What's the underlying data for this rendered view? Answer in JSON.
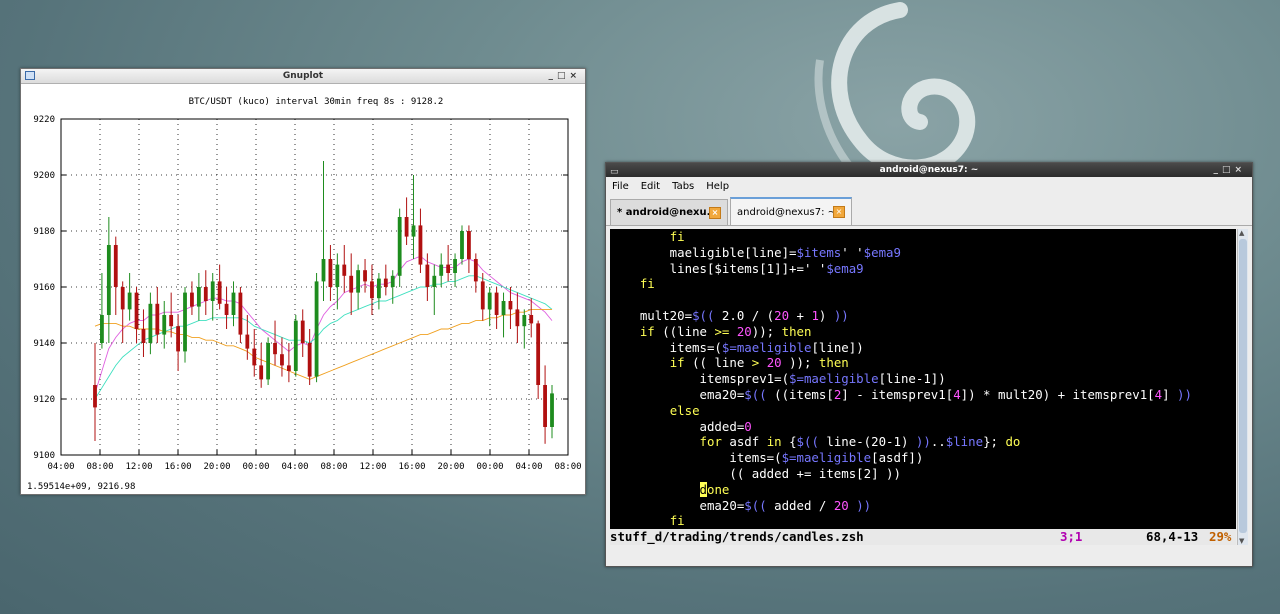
{
  "gnuplot": {
    "window_title": "Gnuplot",
    "status": "1.59514e+09,  9216.98"
  },
  "chart_data": {
    "type": "candlestick",
    "title": "BTC/USDT (kuco) interval 30min freq 8s : 9128.2",
    "xlabel": "",
    "ylabel": "",
    "ylim": [
      9100,
      9220
    ],
    "yticks": [
      "9100",
      "9120",
      "9140",
      "9160",
      "9180",
      "9200",
      "9220"
    ],
    "xticks": [
      "04:00",
      "08:00",
      "12:00",
      "16:00",
      "20:00",
      "00:00",
      "04:00",
      "08:00",
      "12:00",
      "16:00",
      "20:00",
      "00:00",
      "04:00",
      "08:00"
    ],
    "grid": true,
    "colors": {
      "up": "#1e8c1e",
      "down": "#b01010",
      "ema_a": "#e060e0",
      "ema_b": "#40e0c0",
      "ema_c": "#f0a020"
    },
    "candles": [
      [
        9125,
        9140,
        9105,
        9117
      ],
      [
        9140,
        9165,
        9138,
        9150
      ],
      [
        9150,
        9185,
        9140,
        9175
      ],
      [
        9175,
        9178,
        9150,
        9160
      ],
      [
        9160,
        9162,
        9140,
        9152
      ],
      [
        9152,
        9165,
        9148,
        9158
      ],
      [
        9158,
        9160,
        9140,
        9145
      ],
      [
        9145,
        9152,
        9135,
        9140
      ],
      [
        9140,
        9158,
        9136,
        9154
      ],
      [
        9154,
        9160,
        9140,
        9143
      ],
      [
        9143,
        9155,
        9138,
        9150
      ],
      [
        9150,
        9158,
        9142,
        9146
      ],
      [
        9146,
        9150,
        9130,
        9137
      ],
      [
        9137,
        9160,
        9133,
        9158
      ],
      [
        9158,
        9162,
        9150,
        9153
      ],
      [
        9153,
        9165,
        9148,
        9160
      ],
      [
        9160,
        9166,
        9150,
        9155
      ],
      [
        9155,
        9165,
        9148,
        9162
      ],
      [
        9162,
        9168,
        9152,
        9154
      ],
      [
        9154,
        9160,
        9145,
        9150
      ],
      [
        9150,
        9162,
        9146,
        9158
      ],
      [
        9158,
        9160,
        9140,
        9143
      ],
      [
        9143,
        9150,
        9134,
        9138
      ],
      [
        9138,
        9145,
        9128,
        9132
      ],
      [
        9132,
        9140,
        9124,
        9127
      ],
      [
        9127,
        9142,
        9125,
        9140
      ],
      [
        9140,
        9148,
        9132,
        9136
      ],
      [
        9136,
        9142,
        9128,
        9132
      ],
      [
        9132,
        9140,
        9126,
        9130
      ],
      [
        9130,
        9150,
        9128,
        9148
      ],
      [
        9148,
        9152,
        9135,
        9140
      ],
      [
        9140,
        9145,
        9125,
        9128
      ],
      [
        9128,
        9165,
        9126,
        9162
      ],
      [
        9162,
        9205,
        9155,
        9170
      ],
      [
        9170,
        9175,
        9155,
        9160
      ],
      [
        9160,
        9172,
        9152,
        9168
      ],
      [
        9168,
        9175,
        9158,
        9164
      ],
      [
        9164,
        9172,
        9150,
        9158
      ],
      [
        9158,
        9168,
        9152,
        9166
      ],
      [
        9166,
        9170,
        9158,
        9162
      ],
      [
        9162,
        9168,
        9150,
        9156
      ],
      [
        9156,
        9165,
        9152,
        9163
      ],
      [
        9163,
        9168,
        9157,
        9160
      ],
      [
        9160,
        9166,
        9154,
        9164
      ],
      [
        9164,
        9188,
        9160,
        9185
      ],
      [
        9185,
        9192,
        9175,
        9178
      ],
      [
        9178,
        9200,
        9170,
        9182
      ],
      [
        9182,
        9188,
        9165,
        9168
      ],
      [
        9168,
        9172,
        9155,
        9160
      ],
      [
        9160,
        9168,
        9150,
        9164
      ],
      [
        9164,
        9172,
        9160,
        9168
      ],
      [
        9168,
        9175,
        9162,
        9165
      ],
      [
        9165,
        9172,
        9160,
        9170
      ],
      [
        9170,
        9182,
        9168,
        9180
      ],
      [
        9180,
        9182,
        9165,
        9170
      ],
      [
        9170,
        9172,
        9158,
        9162
      ],
      [
        9162,
        9165,
        9148,
        9152
      ],
      [
        9152,
        9160,
        9146,
        9158
      ],
      [
        9158,
        9160,
        9145,
        9150
      ],
      [
        9150,
        9158,
        9142,
        9155
      ],
      [
        9155,
        9160,
        9145,
        9152
      ],
      [
        9152,
        9158,
        9140,
        9146
      ],
      [
        9146,
        9152,
        9138,
        9150
      ],
      [
        9150,
        9156,
        9142,
        9147
      ],
      [
        9147,
        9148,
        9120,
        9125
      ],
      [
        9125,
        9132,
        9104,
        9110
      ],
      [
        9110,
        9125,
        9106,
        9122
      ]
    ],
    "ema_fast": [
      9122,
      9130,
      9138,
      9142,
      9145,
      9147,
      9148,
      9148,
      9150,
      9150,
      9151,
      9151,
      9151,
      9152,
      9153,
      9154,
      9155,
      9156,
      9156,
      9155,
      9155,
      9154,
      9151,
      9148,
      9145,
      9143,
      9141,
      9139,
      9137,
      9139,
      9140,
      9139,
      9145,
      9150,
      9153,
      9155,
      9158,
      9159,
      9160,
      9161,
      9160,
      9161,
      9161,
      9162,
      9166,
      9169,
      9170,
      9171,
      9169,
      9168,
      9167,
      9167,
      9167,
      9169,
      9170,
      9169,
      9166,
      9164,
      9162,
      9160,
      9158,
      9157,
      9156,
      9155,
      9153,
      9151,
      9148
    ],
    "ema_mid": [
      9120,
      9124,
      9128,
      9132,
      9135,
      9137,
      9139,
      9141,
      9142,
      9143,
      9144,
      9145,
      9146,
      9146,
      9147,
      9148,
      9148,
      9149,
      9149,
      9149,
      9149,
      9149,
      9148,
      9146,
      9145,
      9144,
      9143,
      9142,
      9141,
      9141,
      9141,
      9140,
      9142,
      9145,
      9147,
      9148,
      9150,
      9151,
      9152,
      9153,
      9154,
      9155,
      9155,
      9156,
      9157,
      9158,
      9159,
      9160,
      9160,
      9161,
      9161,
      9162,
      9162,
      9163,
      9164,
      9164,
      9163,
      9162,
      9161,
      9160,
      9159,
      9158,
      9157,
      9156,
      9155,
      9154,
      9152
    ],
    "ema_slow": [
      9146,
      9147,
      9147,
      9147,
      9146,
      9146,
      9145,
      9145,
      9145,
      9145,
      9144,
      9144,
      9143,
      9143,
      9142,
      9142,
      9141,
      9141,
      9140,
      9139,
      9139,
      9138,
      9137,
      9135,
      9134,
      9133,
      9132,
      9131,
      9130,
      9129,
      9128,
      9127,
      9128,
      9129,
      9130,
      9131,
      9132,
      9133,
      9134,
      9135,
      9136,
      9137,
      9138,
      9139,
      9140,
      9141,
      9142,
      9143,
      9143,
      9144,
      9145,
      9145,
      9146,
      9147,
      9147,
      9148,
      9148,
      9149,
      9149,
      9150,
      9150,
      9151,
      9151,
      9152,
      9152,
      9152,
      9152
    ]
  },
  "terminal": {
    "window_title": "android@nexus7: ~",
    "menu": [
      "File",
      "Edit",
      "Tabs",
      "Help"
    ],
    "tabs": [
      {
        "label": "* android@nexu..."
      },
      {
        "label": "android@nexus7: ~"
      }
    ],
    "status_file": "stuff_d/trading/trends/candles.zsh",
    "status_mode": "3;1",
    "status_pos": "68,4-13",
    "status_pct": "29%",
    "code": [
      [
        [
          "        ",
          ""
        ],
        [
          "fi",
          "kw"
        ]
      ],
      [
        [
          "        maeligible[line]=",
          ""
        ],
        [
          "$items",
          "var"
        ],
        [
          "' '",
          ""
        ],
        [
          "$ema9",
          "var"
        ]
      ],
      [
        [
          "        lines[$items[1]]+=' '",
          ""
        ],
        [
          "$ema9",
          "var"
        ]
      ],
      [
        [
          "    ",
          ""
        ],
        [
          "fi",
          "kw"
        ]
      ],
      [
        [
          "",
          ""
        ]
      ],
      [
        [
          "    mult20=",
          ""
        ],
        [
          "$((",
          "var"
        ],
        [
          " 2.0 / (",
          ""
        ],
        [
          "20",
          "num"
        ],
        [
          " + ",
          ""
        ],
        [
          "1",
          "num"
        ],
        [
          ")",
          ""
        ],
        [
          " ))",
          "var"
        ]
      ],
      [
        [
          "    ",
          ""
        ],
        [
          "if",
          "kw"
        ],
        [
          " ((line ",
          ""
        ],
        [
          ">=",
          "kw"
        ],
        [
          " ",
          ""
        ],
        [
          "20",
          "num"
        ],
        [
          ")); ",
          ""
        ],
        [
          "then",
          "kw"
        ]
      ],
      [
        [
          "        items=(",
          ""
        ],
        [
          "$=maeligible",
          "var"
        ],
        [
          "[line])",
          ""
        ]
      ],
      [
        [
          "        ",
          ""
        ],
        [
          "if",
          "kw"
        ],
        [
          " (( line ",
          ""
        ],
        [
          ">",
          "kw"
        ],
        [
          " ",
          ""
        ],
        [
          "20",
          "num"
        ],
        [
          " )); ",
          ""
        ],
        [
          "then",
          "kw"
        ]
      ],
      [
        [
          "            itemsprev1=(",
          ""
        ],
        [
          "$=maeligible",
          "var"
        ],
        [
          "[line-1])",
          ""
        ]
      ],
      [
        [
          "            ema20=",
          ""
        ],
        [
          "$((",
          "var"
        ],
        [
          " ((items[",
          ""
        ],
        [
          "2",
          "num"
        ],
        [
          "] - itemsprev1[",
          ""
        ],
        [
          "4",
          "num"
        ],
        [
          "]) * mult20) + itemsprev1[",
          ""
        ],
        [
          "4",
          "num"
        ],
        [
          "] ",
          ""
        ],
        [
          "))",
          "var"
        ]
      ],
      [
        [
          "        ",
          ""
        ],
        [
          "else",
          "kw"
        ]
      ],
      [
        [
          "            added=",
          ""
        ],
        [
          "0",
          "num"
        ]
      ],
      [
        [
          "            ",
          ""
        ],
        [
          "for",
          "kw"
        ],
        [
          " asdf ",
          ""
        ],
        [
          "in",
          "kw"
        ],
        [
          " {",
          ""
        ],
        [
          "$((",
          "var"
        ],
        [
          " line-(20-1) ",
          ""
        ],
        [
          "))",
          "var"
        ],
        [
          "..",
          ""
        ],
        [
          "$line",
          "var"
        ],
        [
          "}; ",
          ""
        ],
        [
          "do",
          "kw"
        ]
      ],
      [
        [
          "                items=(",
          ""
        ],
        [
          "$=maeligible",
          "var"
        ],
        [
          "[asdf])",
          ""
        ]
      ],
      [
        [
          "                (( added += items[2] ))",
          ""
        ]
      ],
      [
        [
          "            ",
          ""
        ],
        [
          "d",
          "cur"
        ],
        [
          "one",
          "kw"
        ]
      ],
      [
        [
          "            ema20=",
          ""
        ],
        [
          "$((",
          "var"
        ],
        [
          " added / ",
          ""
        ],
        [
          "20",
          "num"
        ],
        [
          " ",
          ""
        ],
        [
          "))",
          "var"
        ]
      ],
      [
        [
          "        ",
          ""
        ],
        [
          "fi",
          "kw"
        ]
      ]
    ]
  }
}
